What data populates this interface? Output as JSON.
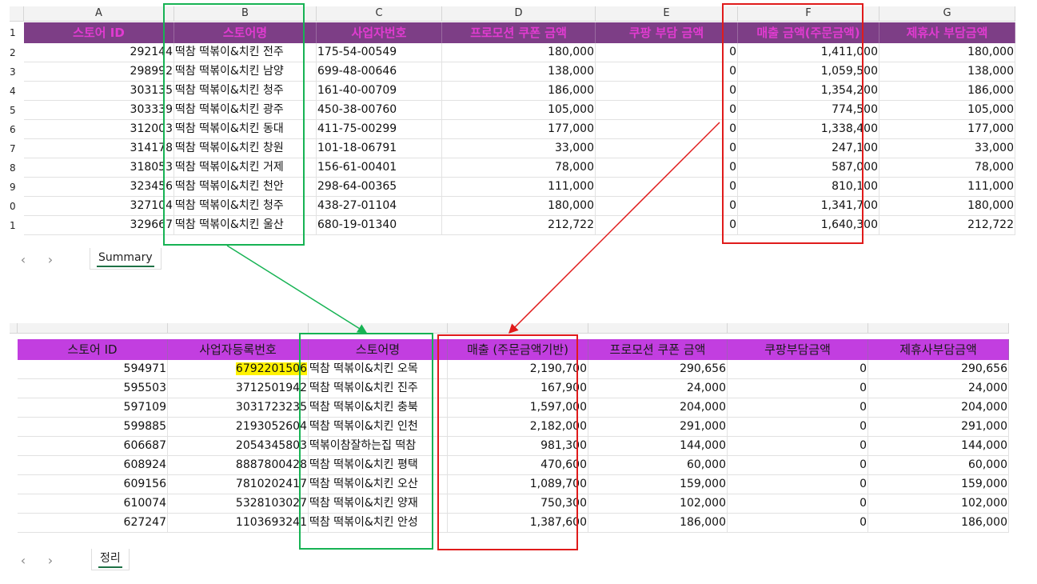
{
  "summary_sheet": {
    "column_letters": [
      "A",
      "B",
      "C",
      "D",
      "E",
      "F",
      "G"
    ],
    "row_numbers": [
      "1",
      "2",
      "3",
      "4",
      "5",
      "6",
      "7",
      "8",
      "9",
      "0",
      "1"
    ],
    "headers": [
      "스토어 ID",
      "스토어명",
      "사업자번호",
      "프로모션 쿠폰 금액",
      "쿠팡 부담 금액",
      "매출 금액(주문금액)",
      "제휴사 부담금액"
    ],
    "rows": [
      [
        "292144",
        "떡참 떡볶이&치킨 전주",
        "175-54-00549",
        "180,000",
        "0",
        "1,411,000",
        "180,000"
      ],
      [
        "298992",
        "떡참 떡볶이&치킨 남양",
        "699-48-00646",
        "138,000",
        "0",
        "1,059,500",
        "138,000"
      ],
      [
        "303135",
        "떡참 떡볶이&치킨 청주",
        "161-40-00709",
        "186,000",
        "0",
        "1,354,200",
        "186,000"
      ],
      [
        "303339",
        "떡참 떡볶이&치킨 광주",
        "450-38-00760",
        "105,000",
        "0",
        "774,500",
        "105,000"
      ],
      [
        "312003",
        "떡참 떡볶이&치킨 동대",
        "411-75-00299",
        "177,000",
        "0",
        "1,338,400",
        "177,000"
      ],
      [
        "314178",
        "떡참 떡볶이&치킨 창원",
        "101-18-06791",
        "33,000",
        "0",
        "247,100",
        "33,000"
      ],
      [
        "318053",
        "떡참 떡볶이&치킨 거제",
        "156-61-00401",
        "78,000",
        "0",
        "587,000",
        "78,000"
      ],
      [
        "323456",
        "떡참 떡볶이&치킨 천안",
        "298-64-00365",
        "111,000",
        "0",
        "810,100",
        "111,000"
      ],
      [
        "327104",
        "떡참 떡볶이&치킨 청주",
        "438-27-01104",
        "180,000",
        "0",
        "1,341,700",
        "180,000"
      ],
      [
        "329667",
        "떡참 떡볶이&치킨 울산",
        "680-19-01340",
        "212,722",
        "0",
        "1,640,300",
        "212,722"
      ]
    ],
    "tab_label": "Summary",
    "nav_prev": "‹",
    "nav_next": "›"
  },
  "cleanup_sheet": {
    "row_numbers": [
      "",
      "",
      "",
      "",
      "",
      "",
      "",
      "",
      "",
      ""
    ],
    "headers": [
      "스토어 ID",
      "사업자등록번호",
      "스토어명",
      "매출 (주문금액기반)",
      "프로모션 쿠폰 금액",
      "쿠팡부담금액",
      "제휴사부담금액"
    ],
    "rows": [
      [
        "594971",
        "6792201506",
        "떡참 떡볶이&치킨 오목",
        "2,190,700",
        "290,656",
        "0",
        "290,656"
      ],
      [
        "595503",
        "3712501942",
        "떡참 떡볶이&치킨 진주",
        "167,900",
        "24,000",
        "0",
        "24,000"
      ],
      [
        "597109",
        "3031723235",
        "떡참 떡볶이&치킨 충북",
        "1,597,000",
        "204,000",
        "0",
        "204,000"
      ],
      [
        "599885",
        "2193052604",
        "떡참 떡볶이&치킨 인천",
        "2,182,000",
        "291,000",
        "0",
        "291,000"
      ],
      [
        "606687",
        "2054345803",
        "떡볶이참잘하는집 떡참",
        "981,300",
        "144,000",
        "0",
        "144,000"
      ],
      [
        "608924",
        "8887800428",
        "떡참 떡볶이&치킨 평택",
        "470,600",
        "60,000",
        "0",
        "60,000"
      ],
      [
        "609156",
        "7810202417",
        "떡참 떡볶이&치킨 오산",
        "1,089,700",
        "159,000",
        "0",
        "159,000"
      ],
      [
        "610074",
        "5328103027",
        "떡참 떡볶이&치킨 양재",
        "750,300",
        "102,000",
        "0",
        "102,000"
      ],
      [
        "627247",
        "1103693241",
        "떡참 떡볶이&치킨 안성",
        "1,387,600",
        "186,000",
        "0",
        "186,000"
      ]
    ],
    "tab_label": "정리",
    "nav_prev": "‹",
    "nav_next": "›"
  },
  "colors": {
    "green_annotation": "#17b354",
    "red_annotation": "#e01b1b",
    "header_purple_dark": "#7d3e86",
    "header_pink_text": "#e13bd1",
    "header_purple_bright": "#c23ee0",
    "highlight_yellow": "#fff200"
  }
}
